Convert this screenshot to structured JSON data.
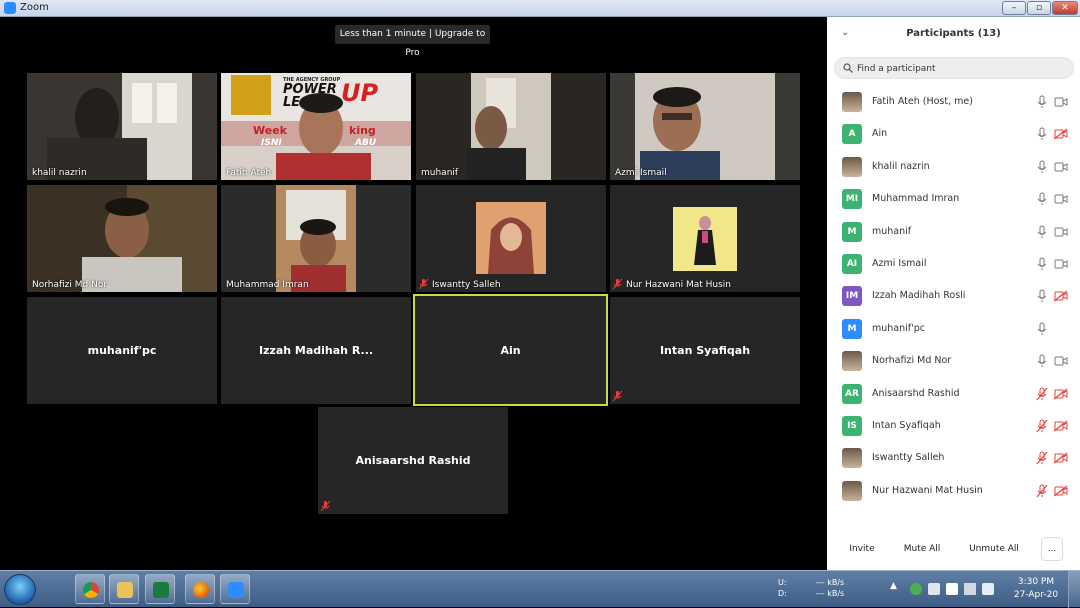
{
  "window": {
    "title": "Zoom"
  },
  "banner": "Less than 1 minute | Upgrade to Pro",
  "video_tiles": [
    {
      "name": "khalil nazrin",
      "muted": false,
      "video": true
    },
    {
      "name": "Fatih Ateh",
      "muted": false,
      "video": true,
      "backdrop_lines": [
        "THE AGENCY GROUP",
        "POWER",
        "LE",
        "UP",
        "Week",
        "king",
        "ISNI",
        "ABU"
      ]
    },
    {
      "name": "muhanif",
      "muted": false,
      "video": true
    },
    {
      "name": "Azmi Ismail",
      "muted": false,
      "video": true
    },
    {
      "name": "Norhafizi Md Nor",
      "muted": false,
      "video": true
    },
    {
      "name": "Muhammad Imran",
      "muted": false,
      "video": true
    },
    {
      "name": "Iswantty Salleh",
      "muted": true,
      "video": false,
      "photo": true
    },
    {
      "name": "Nur Hazwani Mat Husin",
      "muted": true,
      "video": false,
      "photo": true
    },
    {
      "name": "muhanif'pc",
      "muted": false,
      "video": false
    },
    {
      "name": "Izzah Madihah R...",
      "muted": false,
      "video": false
    },
    {
      "name": "Ain",
      "muted": false,
      "video": false,
      "active_speaker": true
    },
    {
      "name": "Intan Syafiqah",
      "muted": true,
      "video": false
    },
    {
      "name": "Anisaarshd Rashid",
      "muted": true,
      "video": false
    }
  ],
  "panel": {
    "title": "Participants (13)",
    "search_placeholder": "Find a participant",
    "participants": [
      {
        "name": "Fatih Ateh (Host, me)",
        "avatar_type": "photo",
        "mic": "on",
        "video": "on"
      },
      {
        "name": "Ain",
        "avatar_type": "initials",
        "initials": "A",
        "color": "#3cb371",
        "mic": "on",
        "video": "off"
      },
      {
        "name": "khalil nazrin",
        "avatar_type": "photo",
        "mic": "on",
        "video": "on"
      },
      {
        "name": "Muhammad Imran",
        "avatar_type": "initials",
        "initials": "MI",
        "color": "#3cb371",
        "mic": "on",
        "video": "on"
      },
      {
        "name": "muhanif",
        "avatar_type": "initials",
        "initials": "M",
        "color": "#3cb371",
        "mic": "on",
        "video": "on"
      },
      {
        "name": "Azmi Ismail",
        "avatar_type": "initials",
        "initials": "AI",
        "color": "#3cb371",
        "mic": "on",
        "video": "on"
      },
      {
        "name": "Izzah Madihah Rosli",
        "avatar_type": "initials",
        "initials": "IM",
        "color": "#7e57c2",
        "mic": "on",
        "video": "off"
      },
      {
        "name": "muhanif'pc",
        "avatar_type": "initials",
        "initials": "M",
        "color": "#2d8cff",
        "mic": "on",
        "video": "none"
      },
      {
        "name": "Norhafizi Md Nor",
        "avatar_type": "photo",
        "mic": "on",
        "video": "on"
      },
      {
        "name": "Anisaarshd Rashid",
        "avatar_type": "initials",
        "initials": "AR",
        "color": "#3cb371",
        "mic": "off",
        "video": "off"
      },
      {
        "name": "Intan Syafiqah",
        "avatar_type": "initials",
        "initials": "IS",
        "color": "#3cb371",
        "mic": "off",
        "video": "off"
      },
      {
        "name": "Iswantty Salleh",
        "avatar_type": "photo",
        "mic": "off",
        "video": "off"
      },
      {
        "name": "Nur Hazwani Mat Husin",
        "avatar_type": "photo",
        "mic": "off",
        "video": "off"
      }
    ],
    "footer": {
      "invite": "Invite",
      "mute_all": "Mute All",
      "unmute_all": "Unmute All",
      "more": "..."
    }
  },
  "taskbar": {
    "apps": [
      "chrome-icon",
      "folder-icon",
      "excel-icon",
      "firefox-icon",
      "zoom-icon"
    ],
    "net_upload_label": "U:",
    "net_download_label": "D:",
    "net_upload": "--- kB/s",
    "net_download": "--- kB/s",
    "time": "3:30 PM",
    "date": "27-Apr-20"
  },
  "colors": {
    "muted_red": "#e8403b",
    "active_border": "#c9d94a",
    "zoom_blue": "#2d8cff"
  }
}
